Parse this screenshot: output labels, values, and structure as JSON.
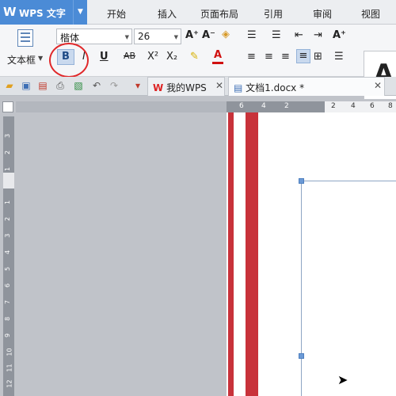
{
  "app": {
    "logo": "W",
    "name": "WPS 文字"
  },
  "menu": [
    "开始",
    "插入",
    "页面布局",
    "引用",
    "审阅",
    "视图"
  ],
  "ribbon": {
    "textbox_label": "文本框",
    "font_name": "楷体",
    "font_size": "26",
    "bold_label": "B",
    "italic_label": "I",
    "underline_label": "U",
    "strike_label": "AB",
    "superscript_label": "X²",
    "subscript_label": "X₂",
    "grow_font": "A⁺",
    "shrink_font": "A⁻",
    "font_color_label": "A",
    "style_preview": "A"
  },
  "tabs": [
    {
      "label": "我的WPS"
    },
    {
      "label": "文档1.docx *"
    }
  ],
  "ruler": {
    "top_numbers": [
      "6",
      "4",
      "2",
      "2",
      "4",
      "6",
      "8"
    ],
    "left_numbers": [
      "3",
      "2",
      "1",
      "1",
      "2",
      "3",
      "4",
      "5",
      "6",
      "7",
      "8",
      "9",
      "10",
      "11",
      "12"
    ]
  },
  "colors": {
    "accent": "#4b8bd6",
    "highlight_circle": "#e0282a",
    "page_bar": "#c8323a"
  }
}
